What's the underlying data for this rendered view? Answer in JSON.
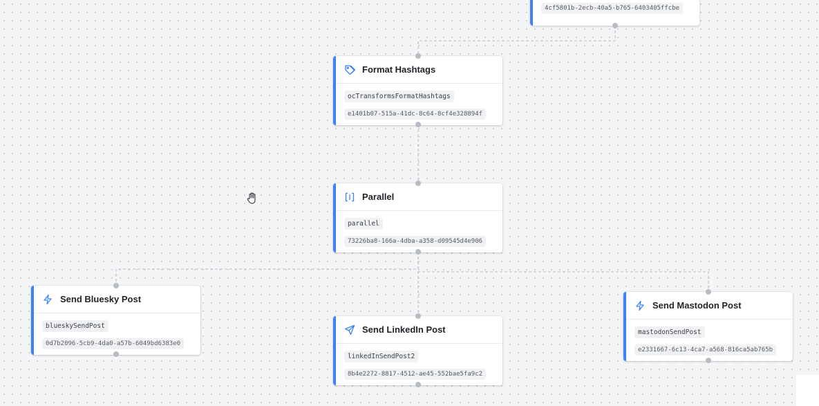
{
  "nodes": {
    "top": {
      "id_text": "4cf5801b-2ecb-40a5-b765-6403405ffcbe"
    },
    "format_hashtags": {
      "title": "Format Hashtags",
      "action": "ocTransformsFormatHashtags",
      "id_text": "e1401b07-515a-41dc-8c64-8cf4e328894f",
      "icon": "tag-icon"
    },
    "parallel": {
      "title": "Parallel",
      "action": "parallel",
      "id_text": "73226ba8-166a-4dba-a358-d09545d4e906",
      "icon": "parallel-icon"
    },
    "send_bluesky": {
      "title": "Send Bluesky Post",
      "action": "blueskySendPost",
      "id_text": "0d7b2096-5cb9-4da0-a57b-6049bd6383e0",
      "icon": "lightning-icon"
    },
    "send_linkedin": {
      "title": "Send LinkedIn Post",
      "action": "linkedInSendPost2",
      "id_text": "8b4e2272-8817-4512-ae45-552bae5fa9c2",
      "icon": "send-icon"
    },
    "send_mastodon": {
      "title": "Send Mastodon Post",
      "action": "mastodonSendPost",
      "id_text": "e2331667-6c13-4ca7-a568-816ca5ab765b",
      "icon": "lightning-icon"
    }
  },
  "colors": {
    "accent": "#3b82f6",
    "edge": "#c3c6cc",
    "canvas": "#f4f5f7"
  },
  "cursor": "hand-pan-icon"
}
